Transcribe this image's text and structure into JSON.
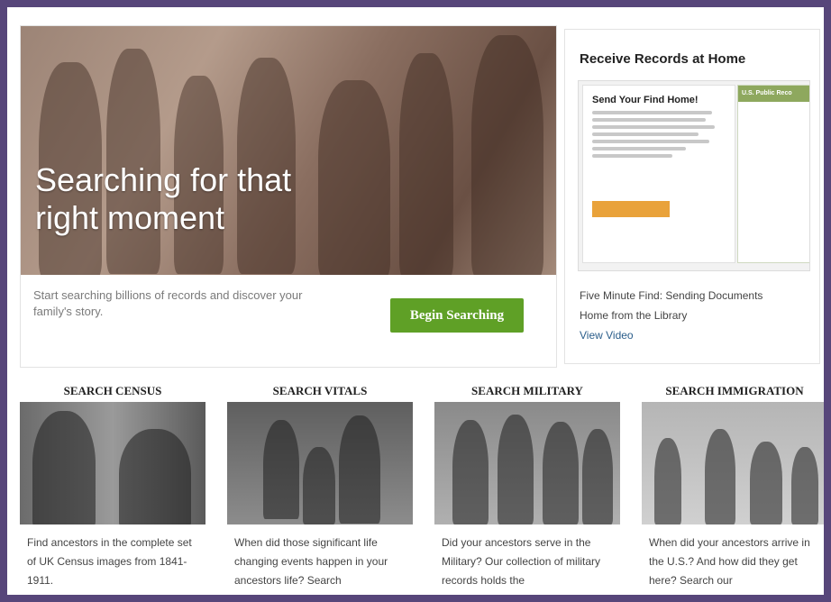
{
  "hero": {
    "title_line1": "Searching for that",
    "title_line2": "right moment",
    "subtitle": "Start searching billions of records and discover your family's story.",
    "button": "Begin Searching"
  },
  "panel": {
    "title": "Receive Records at Home",
    "preview_heading": "Send Your Find Home!",
    "preview_doc_header": "U.S. Public Reco",
    "links": {
      "line1": "Five Minute Find: Sending Documents",
      "line2": "Home from the Library",
      "video": "View Video"
    }
  },
  "cards": [
    {
      "title": "SEARCH CENSUS",
      "text": "Find ancestors in the complete set of UK Census images from 1841-1911."
    },
    {
      "title": "SEARCH VITALS",
      "text": "When did those significant life changing events happen in your ancestors life? Search"
    },
    {
      "title": "SEARCH MILITARY",
      "text": "Did your ancestors serve in the Military? Our collection of military records holds the"
    },
    {
      "title": "SEARCH IMMIGRATION",
      "text": "When did your ancestors arrive in the U.S.? And how did they get here? Search our"
    }
  ],
  "colors": {
    "background": "#57467a",
    "button_green": "#5fa026",
    "preview_button": "#e9a23a"
  }
}
